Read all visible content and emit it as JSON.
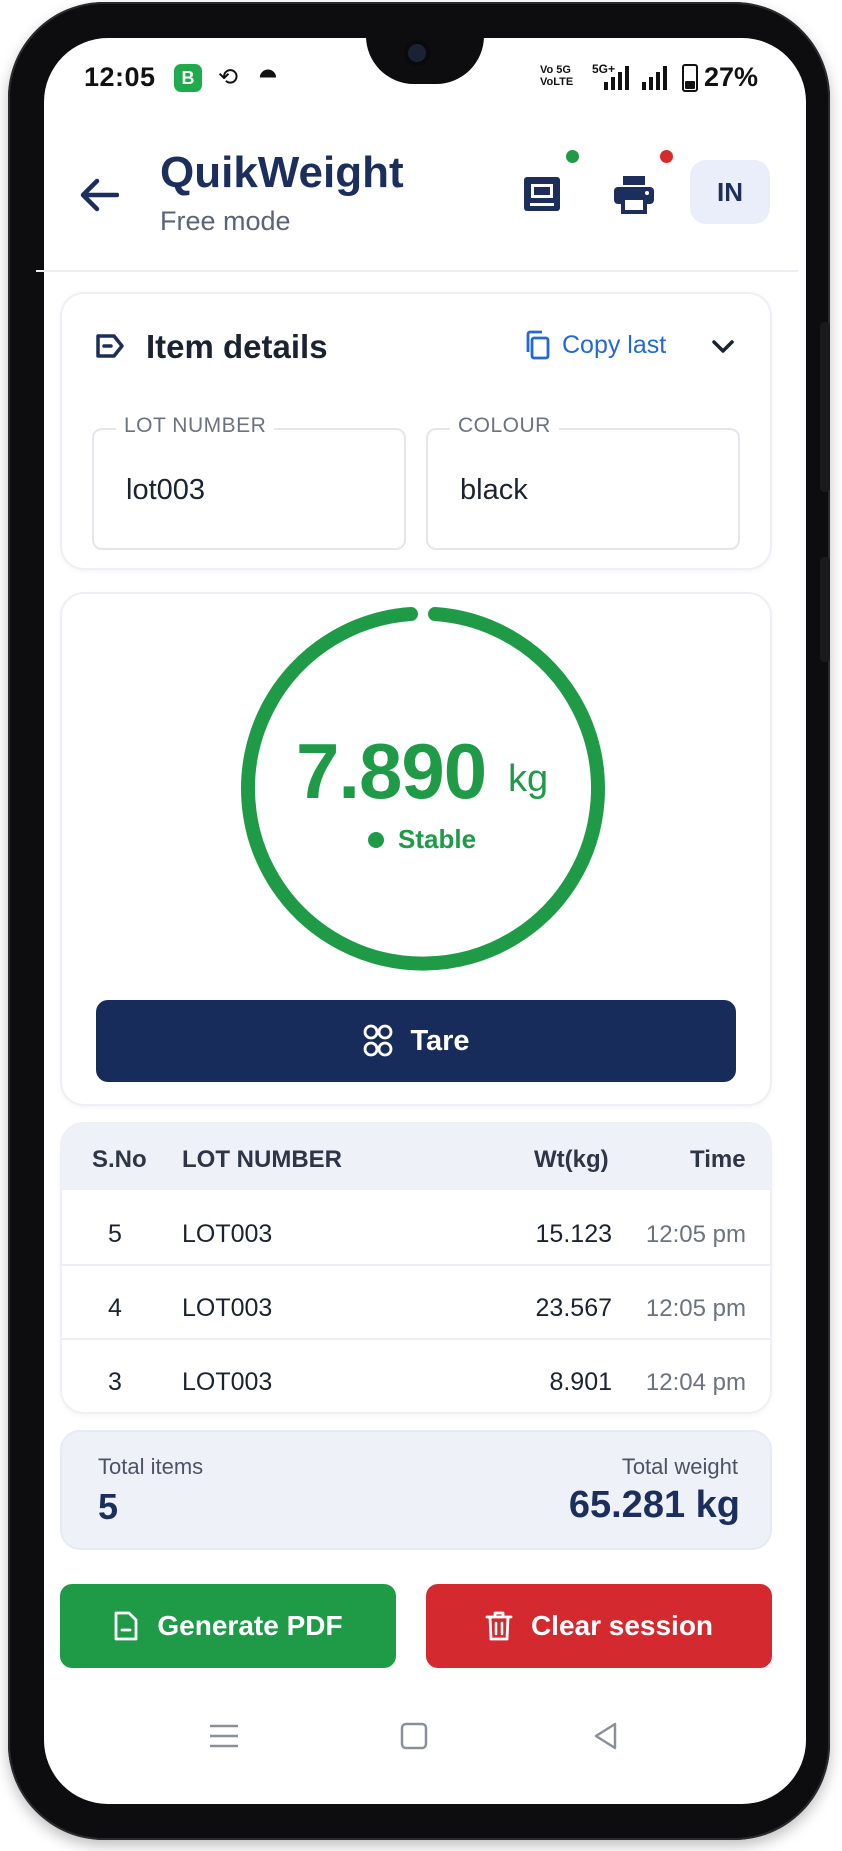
{
  "status_bar": {
    "time": "12:05",
    "network_top": "Vo 5G",
    "network_bottom": "VoLTE",
    "network_5g": "5G+",
    "battery": "27%"
  },
  "header": {
    "title": "QuikWeight",
    "subtitle": "Free mode",
    "language": "IN",
    "scale_status_color": "#1f9b48",
    "printer_status_color": "#d62b2b"
  },
  "item_details": {
    "title": "Item details",
    "copy_last_label": "Copy last",
    "fields": {
      "lot_number": {
        "label": "LOT NUMBER",
        "value": "lot003"
      },
      "colour": {
        "label": "COLOUR",
        "value": "black"
      }
    }
  },
  "weight": {
    "value": "7.890",
    "unit": "kg",
    "status": "Stable",
    "tare_label": "Tare"
  },
  "table": {
    "headers": {
      "sno": "S.No",
      "lot": "LOT NUMBER",
      "wt": "Wt(kg)",
      "time": "Time"
    },
    "rows": [
      {
        "sno": "5",
        "lot": "LOT003",
        "wt": "15.123",
        "time": "12:05 pm"
      },
      {
        "sno": "4",
        "lot": "LOT003",
        "wt": "23.567",
        "time": "12:05 pm"
      },
      {
        "sno": "3",
        "lot": "LOT003",
        "wt": "8.901",
        "time": "12:04 pm"
      }
    ]
  },
  "totals": {
    "items_label": "Total items",
    "items_value": "5",
    "weight_label": "Total weight",
    "weight_value": "65.281 kg"
  },
  "actions": {
    "generate_pdf": "Generate PDF",
    "clear_session": "Clear session"
  },
  "colors": {
    "brand_navy": "#172c5a",
    "accent_green": "#1f9b48",
    "danger_red": "#d42a2f",
    "link_blue": "#2467d6"
  }
}
